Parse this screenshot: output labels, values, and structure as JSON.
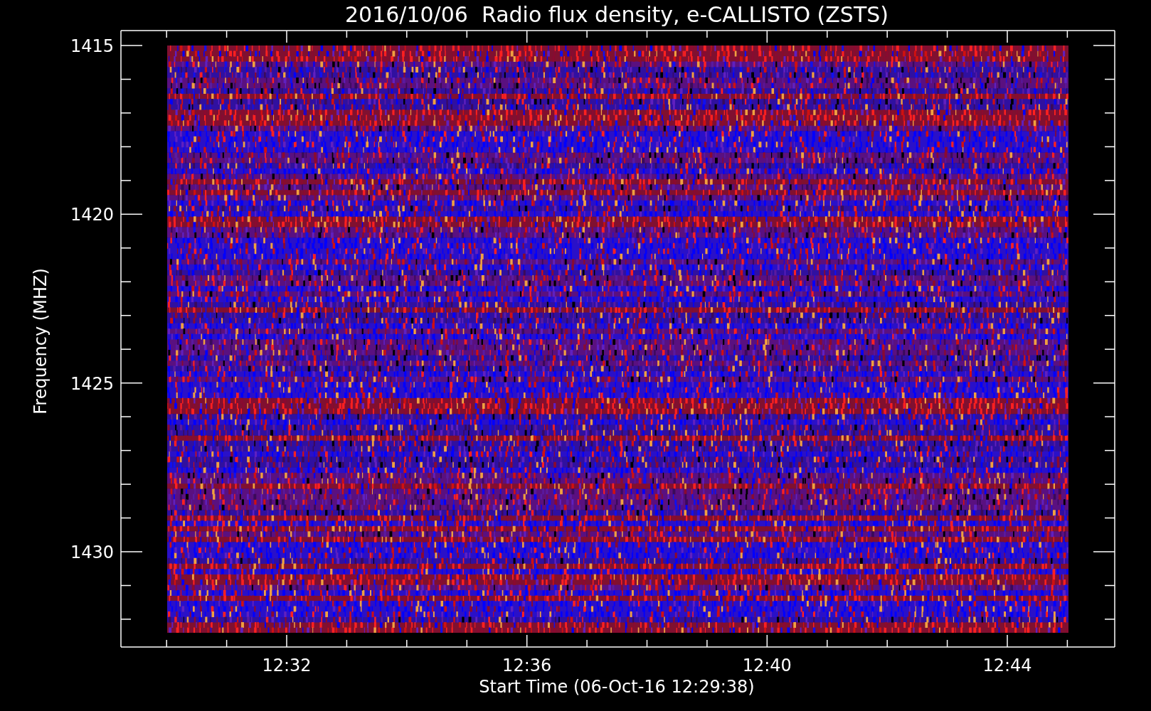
{
  "title": "2016/10/06  Radio flux density, e-CALLISTO (ZSTS)",
  "plot": {
    "ylabel": "Frequency (MHZ)",
    "xlabel": "Start Time (06-Oct-16 12:29:38)",
    "yticks": [
      "1415",
      "1420",
      "1425",
      "1430"
    ],
    "xticks": [
      "12:32",
      "12:36",
      "12:40",
      "12:44"
    ]
  }
}
